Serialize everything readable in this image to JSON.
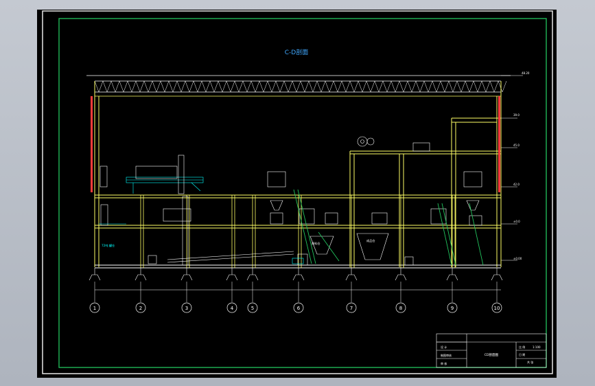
{
  "drawing": {
    "section_title": "C-D剖面",
    "elevations": [
      "48.20",
      "39.0",
      "45.0",
      "42.0",
      "±0.0",
      "±0.00"
    ],
    "grid_axes": [
      "1",
      "2",
      "3",
      "4",
      "5",
      "6",
      "7",
      "8",
      "9",
      "10"
    ],
    "equipment_labels": [
      "原料仓",
      "成品仓",
      "72吨 罐仓"
    ]
  },
  "title_block": {
    "drawing_name": "CD剖面图",
    "left_labels": [
      "设 计",
      "制图审核",
      "审 核",
      "校 对"
    ],
    "right_labels": [
      "比 例",
      "日 期"
    ],
    "scale_value": "1:100",
    "extra_labels": [
      "共 张",
      "第 张"
    ]
  },
  "colors": {
    "background": "#000000",
    "frame": "#22c55e",
    "structure": "#ffff66",
    "equipment": "#ffffff",
    "conveyor": "#00ffff",
    "accent": "#ff3b3b",
    "title": "#40a8ff"
  }
}
